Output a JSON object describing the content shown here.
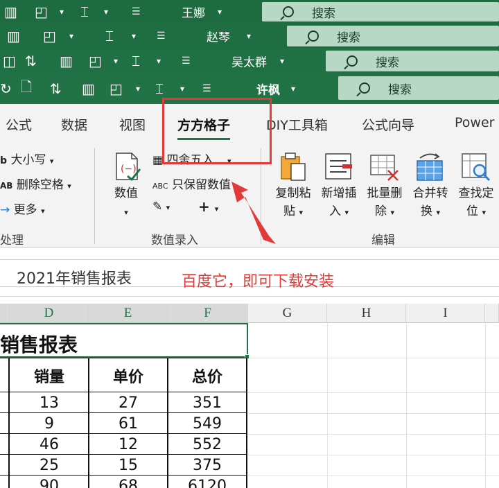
{
  "title_bars": [
    {
      "user": "王娜",
      "search": "搜索"
    },
    {
      "user": "赵琴",
      "search": "搜索"
    },
    {
      "user": "吴太群",
      "search": "搜索"
    },
    {
      "user": "许枫",
      "search": "搜索"
    }
  ],
  "tabs": [
    "公式",
    "数据",
    "视图",
    "方方格子",
    "DIY工具箱",
    "公式向导",
    "Power"
  ],
  "active_tab": "方方格子",
  "ribbon": {
    "group_left": {
      "items": [
        "大小写",
        "删除空格",
        "更多"
      ],
      "name": "处理"
    },
    "group_value": {
      "big_button": "数值",
      "items": [
        "四舍五入",
        "只保留数值"
      ],
      "plus": "+",
      "name": "数值录入"
    },
    "group_edit": {
      "buttons": [
        {
          "line1": "复制粘",
          "line2": "贴"
        },
        {
          "line1": "新增插",
          "line2": "入"
        },
        {
          "line1": "批量删",
          "line2": "除"
        },
        {
          "line1": "合并转",
          "line2": "换"
        },
        {
          "line1": "查找定",
          "line2": "位"
        }
      ],
      "name": "编辑"
    }
  },
  "formula_bar": {
    "value": "2021年销售报表",
    "annotation": "百度它，即可下载安装"
  },
  "sheet": {
    "columns": [
      "D",
      "E",
      "F",
      "G",
      "H",
      "I"
    ],
    "title": "销售报表",
    "headers": [
      "销量",
      "单价",
      "总价"
    ],
    "rows": [
      [
        "13",
        "27",
        "351"
      ],
      [
        "9",
        "61",
        "549"
      ],
      [
        "46",
        "12",
        "552"
      ],
      [
        "25",
        "15",
        "375"
      ],
      [
        "90",
        "68",
        "6120"
      ]
    ]
  },
  "colors": {
    "excel_green": "#217346",
    "annotation_red": "#e23a3a"
  }
}
